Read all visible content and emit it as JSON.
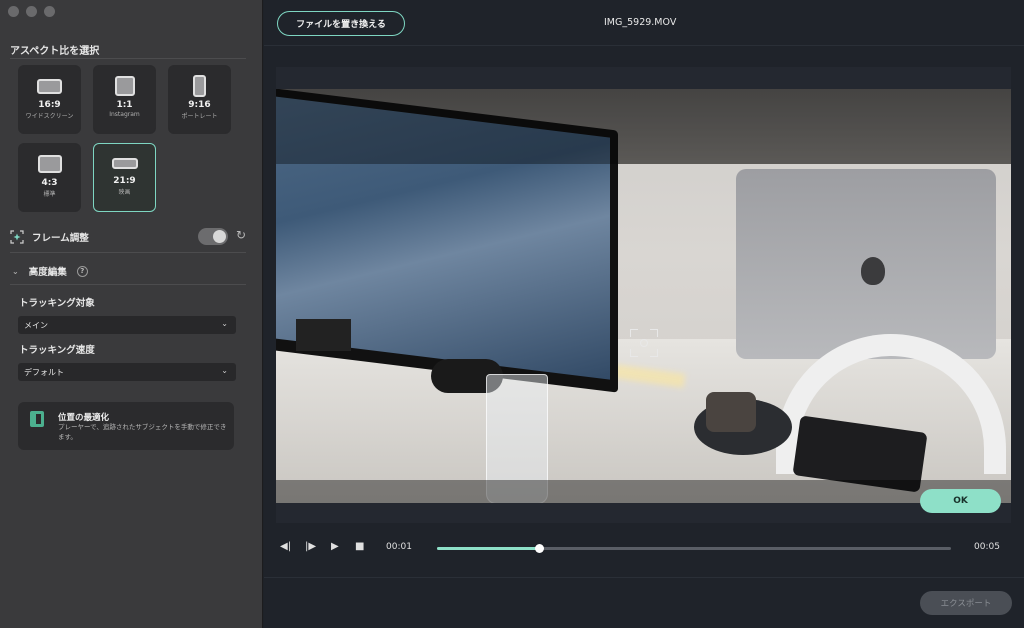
{
  "sidebar": {
    "aspect_title": "アスペクト比を選択",
    "ratios": [
      {
        "main": "16:9",
        "sub": "ワイドスクリーン",
        "icon": "landscape-wide-icon"
      },
      {
        "main": "1:1",
        "sub": "Instagram",
        "icon": "square-icon"
      },
      {
        "main": "9:16",
        "sub": "ポートレート",
        "icon": "portrait-icon"
      },
      {
        "main": "4:3",
        "sub": "標準",
        "icon": "landscape-standard-icon"
      },
      {
        "main": "21:9",
        "sub": "映画",
        "icon": "cinema-wide-icon",
        "selected": true
      }
    ],
    "frame_adjust_label": "フレーム調整",
    "frame_adjust_on": true,
    "advanced_label": "高度編集",
    "help_glyph": "?",
    "tracking_target_label": "トラッキング対象",
    "tracking_target_value": "メイン",
    "tracking_speed_label": "トラッキング速度",
    "tracking_speed_value": "デフォルト",
    "optimize_title": "位置の最適化",
    "optimize_desc": "プレーヤーで、追跡されたサブジェクトを手動で修正できます。"
  },
  "main": {
    "replace_button": "ファイルを置き換える",
    "filename": "IMG_5929.MOV",
    "ok_button": "OK",
    "current_time": "00:01",
    "total_time": "00:05",
    "progress": 0.2,
    "export_button": "エクスポート"
  },
  "colors": {
    "accent": "#7ed6c2",
    "ok_bg": "#8ee0c8",
    "sidebar_bg": "#3a3a3c",
    "main_bg": "#1f232a"
  }
}
